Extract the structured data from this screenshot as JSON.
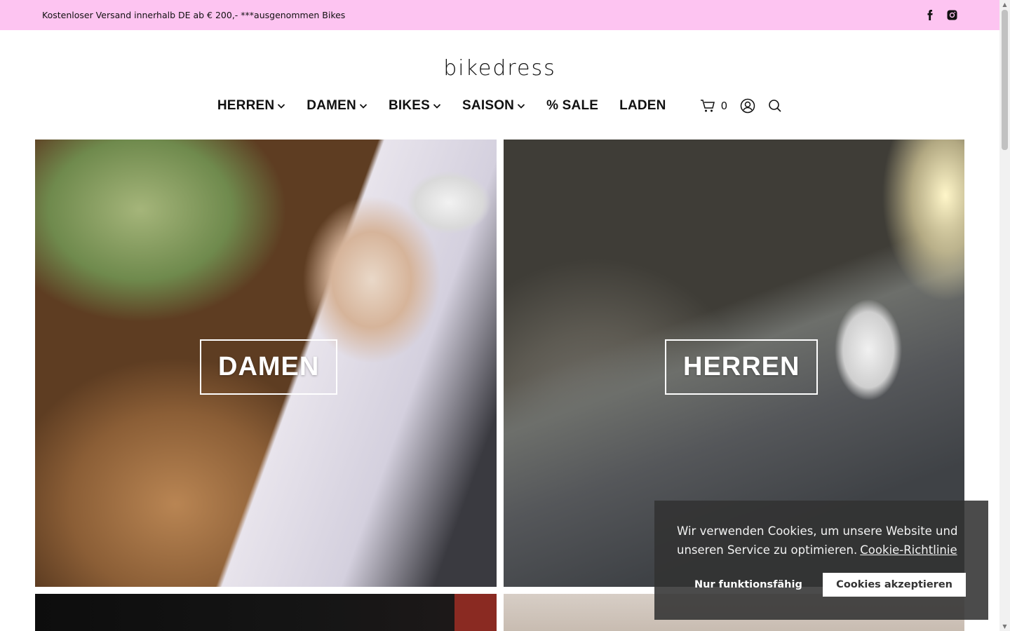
{
  "topbar": {
    "shipping_text": "Kostenloser Versand innerhalb DE ab € 200,- ***ausgenommen Bikes",
    "background_color": "#fdc4f1",
    "social_icons": [
      "facebook-icon",
      "instagram-icon"
    ]
  },
  "header": {
    "logo_text": "bikedress"
  },
  "nav": {
    "items": [
      {
        "label": "HERREN",
        "has_dropdown": true
      },
      {
        "label": "DAMEN",
        "has_dropdown": true
      },
      {
        "label": "BIKES",
        "has_dropdown": true
      },
      {
        "label": "SAISON",
        "has_dropdown": true
      },
      {
        "label": "% SALE",
        "has_dropdown": false
      },
      {
        "label": "LADEN",
        "has_dropdown": false
      }
    ],
    "cart_count": "0",
    "icons": [
      "cart-icon",
      "account-icon",
      "search-icon"
    ]
  },
  "tiles": {
    "damen_label": "DAMEN",
    "herren_label": "HERREN"
  },
  "cookie_banner": {
    "message": "Wir verwenden Cookies, um unsere Website und unseren Service zu optimieren.",
    "policy_link": "Cookie-Richtlinie",
    "decline_label": "Nur funktionsfähig",
    "accept_label": "Cookies akzeptieren"
  }
}
